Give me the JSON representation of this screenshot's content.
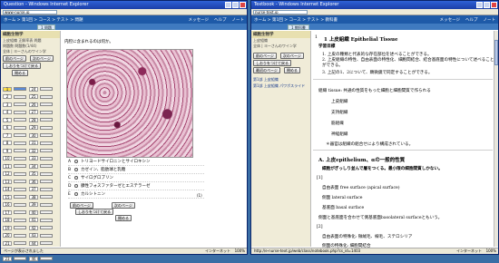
{
  "left_window": {
    "title": "Question - Windows Internet Explorer",
    "address": "www-nurse.jp",
    "crumbs": "ホーム > 第1回 > コース > テスト > 問題",
    "header_links": [
      "メッセージ",
      "ヘルプ",
      "ノート"
    ],
    "tab_label": "1 問題",
    "sidebar": {
      "title": "細胞生物学",
      "subtitle1": "上皮組織 正解率表 問題",
      "subtitle2": "問題数 問題数(1/44)",
      "subtitle3": "全体 | ヨーさんのワイン学",
      "btn_prev": "前のページ",
      "btn_next": "次のページ",
      "btn_check": "しおりをつけて戻る",
      "btn_exit": "閉める",
      "questions": [
        "1",
        "2",
        "3",
        "4",
        "5",
        "6",
        "7",
        "8",
        "9",
        "10",
        "11",
        "12",
        "13",
        "14",
        "15",
        "16",
        "17",
        "18",
        "19",
        "20",
        "21",
        "22",
        "23"
      ],
      "questions_right": [
        "24",
        "25",
        "26",
        "27",
        "28",
        "29",
        "30",
        "31",
        "32",
        "33",
        "34",
        "35",
        "36",
        "37",
        "38",
        "39",
        "40",
        "41",
        "42",
        "43",
        "44",
        "45",
        "46"
      ]
    },
    "question_text": "内腔に含まれるのは何か。",
    "options": [
      {
        "label": "A",
        "text": "トリヨードサイロニンとサイロキシン"
      },
      {
        "label": "B",
        "text": "カゼイン、脂肪球と乳糖"
      },
      {
        "label": "C",
        "text": "サイログロブリン"
      },
      {
        "label": "D",
        "text": "腺性フォスファターゼとエステラーゼ"
      },
      {
        "label": "E",
        "text": "カルシトニン"
      }
    ],
    "score_label": "(1)",
    "ctrl_prev": "前のページ",
    "ctrl_next": "次のページ",
    "ctrl_check": "しおりをつけて戻る",
    "ctrl_exit": "閉める",
    "status": "ページが表示されました",
    "zone": "インターネット",
    "zoom": "100%"
  },
  "right_window": {
    "title": "Textbook - Windows Internet Explorer",
    "address": "nurse-text.jp",
    "crumbs": "ホーム > 第1回 > コース > テスト > 教科書",
    "header_links": [
      "メッセージ",
      "ヘルプ",
      "ノート"
    ],
    "tab_label": "1 教科書",
    "sidebar": {
      "title": "細胞生物学",
      "subtitle1": "上皮組織",
      "subtitle2": "全体 | ヨーさんのワイン学",
      "btn_prev": "前のページ",
      "btn_next": "次のページ",
      "btn_check": "しおりをつけて戻る",
      "btn_first": "最初のページ",
      "btn_exit": "閉める",
      "section_a": "第1部 上皮組織",
      "section_b": "第1部 上皮組織 パワポスライド"
    },
    "section_num": "1",
    "heading": "1 上皮組織 Epithelial Tissue",
    "subheading": "学習目標",
    "objectives": [
      "1. 上皮の種類と代表的な存在部位を述べることができる。",
      "2. 上皮組織の特性、自由表面の特性化、細胞間結合、結合基底面の特性について述べることができる。",
      "3. 上記の1、2について、顕微鏡で同定することができる。"
    ],
    "tissue_intro": "組織 tissue: 共通の性質をもった細胞と細胞間質で作られる",
    "tissue_types": [
      "上皮組織",
      "支持組織",
      "筋組織",
      "神経組織"
    ],
    "tissue_note": "＊器官は組織の組合せにより構成されている。",
    "section_a_title": "A. 上皮epithelium、αの一般的性質",
    "section_a_desc": "細胞がぎっしり並んで層をつくる。最小限の細胞間質しかない。",
    "marker": "[1]",
    "surfaces": [
      "自由表面 free surface (apical surface)",
      "側面 lateral surface",
      "基底面 basal surface"
    ],
    "boundary": "側面と基底面を合わせて側基底面basolateral surfaceともいう。",
    "marker2": "[2]",
    "free_surface": "自由表面の特殊化: 微絨毛、線毛、ステロシリア",
    "junction": "側面の特殊化: 細胞間結合",
    "status": "http://e-nurse-text.jp/web/class/notebook.php?cs_id=1403",
    "zone": "インターネット",
    "zoom": "100%"
  }
}
